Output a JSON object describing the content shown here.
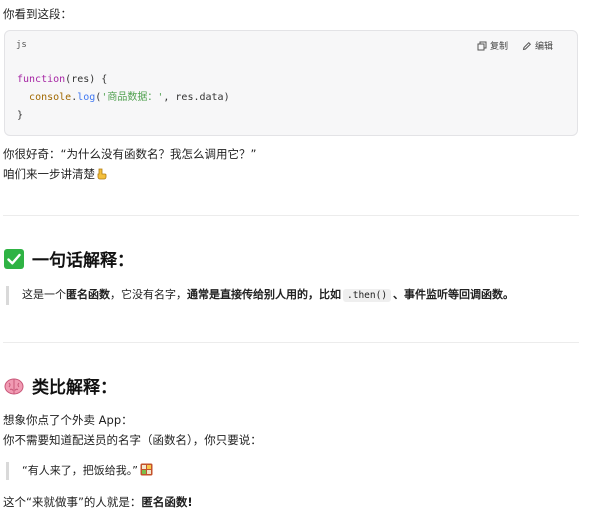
{
  "intro": "你看到这段：",
  "code": {
    "lang": "js",
    "copy_label": "复制",
    "edit_label": "编辑",
    "lines": {
      "l1_kw": "function",
      "l1_rest": "(res) {",
      "l2_obj": "console",
      "l2_dot": ".",
      "l2_fn": "log",
      "l2_open": "(",
      "l2_str": "'商品数据：'",
      "l2_rest": ", res.data)",
      "l3": "}"
    }
  },
  "question": "你很好奇：“为什么没有函数名？我怎么调用它？”",
  "step": "咱们来一步讲清楚",
  "section1": {
    "title": "一句话解释：",
    "quote": {
      "p1": "这是一个",
      "b1": "匿名函数",
      "p2": "，它没有名字，",
      "b2": "通常是直接传给别人用的，比如",
      "code": ".then()",
      "b3": "、事件监听等回调函数。"
    }
  },
  "section2": {
    "title": "类比解释：",
    "line1": "想象你点了个外卖 App：",
    "line2": "你不需要知道配送员的名字（函数名），你只要说：",
    "quote": "“有人来了，把饭给我。”",
    "conclusion_plain": "这个“来就做事”的人就是：",
    "conclusion_bold": "匿名函数!"
  },
  "colors": {
    "check_green": "#2fb344",
    "brain_pink": "#f19bb3",
    "keyword": "#a626a4",
    "string": "#50a14f",
    "function": "#4078f2"
  },
  "icons": {
    "copy": "copy-icon",
    "edit": "edit-icon",
    "point": "point-down-icon",
    "check": "check-mark-icon",
    "brain": "brain-icon",
    "bento": "bento-box-icon"
  }
}
